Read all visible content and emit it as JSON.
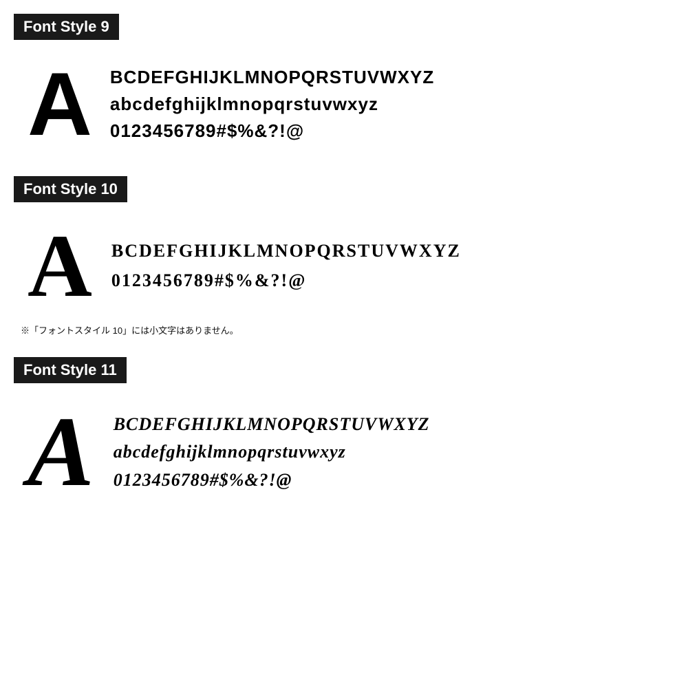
{
  "sections": [
    {
      "id": "font-style-9",
      "label": "Font Style 9",
      "big_letter": "A",
      "lines": [
        "BCDEFGHIJKLMNOPQRSTUVWXYZ",
        "abcdefghijklmnopqrstuvwxyz",
        "0123456789#$%&?!@"
      ],
      "note": null
    },
    {
      "id": "font-style-10",
      "label": "Font Style 10",
      "big_letter": "A",
      "lines": [
        "BCDEFGHIJKLMNOPQRSTUVWXYZ",
        "0123456789#$%&?!@"
      ],
      "note": "※「フォントスタイル 10」には小文字はありません。"
    },
    {
      "id": "font-style-11",
      "label": "Font Style 11",
      "big_letter": "A",
      "lines": [
        "BCDEFGHIJKLMNOPQRSTUVWXYZ",
        "abcdefghijklmnopqrstuvwxyz",
        "0123456789#$%&?!@"
      ],
      "note": null
    }
  ]
}
